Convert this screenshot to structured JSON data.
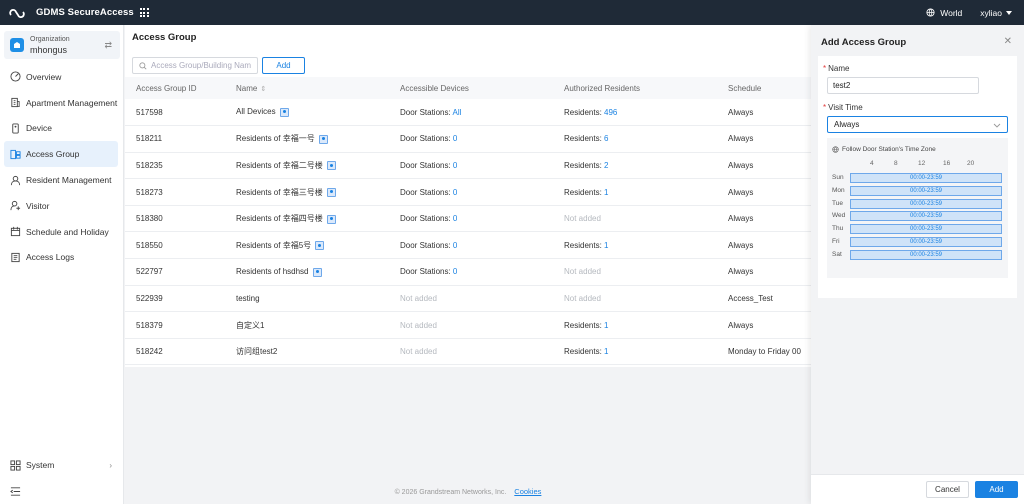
{
  "app": {
    "title": "GDMS SecureAccess",
    "region": "World",
    "username": "xyliao"
  },
  "sidebar": {
    "org_label": "Organization",
    "org_name": "mhongus",
    "items": [
      {
        "label": "Overview",
        "icon": "overview-icon"
      },
      {
        "label": "Apartment Management",
        "icon": "building-icon"
      },
      {
        "label": "Device",
        "icon": "device-icon"
      },
      {
        "label": "Access Group",
        "icon": "access-group-icon",
        "active": true
      },
      {
        "label": "Resident Management",
        "icon": "resident-icon"
      },
      {
        "label": "Visitor",
        "icon": "visitor-icon"
      },
      {
        "label": "Schedule and Holiday",
        "icon": "calendar-icon"
      },
      {
        "label": "Access Logs",
        "icon": "logs-icon"
      }
    ],
    "system_label": "System"
  },
  "main": {
    "title": "Access Group",
    "search_placeholder": "Access Group/Building Nam",
    "add_label": "Add",
    "columns": [
      "Access Group ID",
      "Name",
      "Accessible Devices",
      "Authorized Residents",
      "Schedule"
    ],
    "rows": [
      {
        "id": "517598",
        "name": "All Devices",
        "badge": true,
        "dev_prefix": "Door Stations: ",
        "dev_value": "All",
        "res_prefix": "Residents: ",
        "res_value": "496",
        "schedule": "Always"
      },
      {
        "id": "518211",
        "name": "Residents of 幸福一号",
        "badge": true,
        "dev_prefix": "Door Stations: ",
        "dev_value": "0",
        "res_prefix": "Residents: ",
        "res_value": "6",
        "schedule": "Always"
      },
      {
        "id": "518235",
        "name": "Residents of 幸福二号楼",
        "badge": true,
        "dev_prefix": "Door Stations: ",
        "dev_value": "0",
        "res_prefix": "Residents: ",
        "res_value": "2",
        "schedule": "Always"
      },
      {
        "id": "518273",
        "name": "Residents of 幸福三号楼",
        "badge": true,
        "dev_prefix": "Door Stations: ",
        "dev_value": "0",
        "res_prefix": "Residents: ",
        "res_value": "1",
        "schedule": "Always"
      },
      {
        "id": "518380",
        "name": "Residents of 幸福四号楼",
        "badge": true,
        "dev_prefix": "Door Stations: ",
        "dev_value": "0",
        "res_prefix": "",
        "res_value": "Not added",
        "schedule": "Always"
      },
      {
        "id": "518550",
        "name": "Residents of 幸福5号",
        "badge": true,
        "dev_prefix": "Door Stations: ",
        "dev_value": "0",
        "res_prefix": "Residents: ",
        "res_value": "1",
        "schedule": "Always"
      },
      {
        "id": "522797",
        "name": "Residents of hsdhsd",
        "badge": true,
        "dev_prefix": "Door Stations: ",
        "dev_value": "0",
        "res_prefix": "",
        "res_value": "Not added",
        "schedule": "Always"
      },
      {
        "id": "522939",
        "name": "testing",
        "badge": false,
        "dev_prefix": "",
        "dev_value": "Not added",
        "res_prefix": "",
        "res_value": "Not added",
        "schedule": "Access_Test"
      },
      {
        "id": "518379",
        "name": "自定义1",
        "badge": false,
        "dev_prefix": "",
        "dev_value": "Not added",
        "res_prefix": "Residents: ",
        "res_value": "1",
        "schedule": "Always"
      },
      {
        "id": "518242",
        "name": "访问组test2",
        "badge": false,
        "dev_prefix": "",
        "dev_value": "Not added",
        "res_prefix": "Residents: ",
        "res_value": "1",
        "schedule": "Monday to Friday 00"
      }
    ],
    "footer_copyright": "© 2026 Grandstream Networks, Inc.",
    "footer_cookies": "Cookies"
  },
  "drawer": {
    "title": "Add Access Group",
    "name_label": "Name",
    "name_value": "test2",
    "visit_label": "Visit Time",
    "visit_value": "Always",
    "timezone_label": "Follow Door Station's Time Zone",
    "hour_ticks": [
      "4",
      "8",
      "12",
      "16",
      "20"
    ],
    "days": [
      {
        "day": "Sun",
        "range": "00:00-23:59"
      },
      {
        "day": "Mon",
        "range": "00:00-23:59"
      },
      {
        "day": "Tue",
        "range": "00:00-23:59"
      },
      {
        "day": "Wed",
        "range": "00:00-23:59"
      },
      {
        "day": "Thu",
        "range": "00:00-23:59"
      },
      {
        "day": "Fri",
        "range": "00:00-23:59"
      },
      {
        "day": "Sat",
        "range": "00:00-23:59"
      }
    ],
    "cancel_label": "Cancel",
    "submit_label": "Add"
  }
}
